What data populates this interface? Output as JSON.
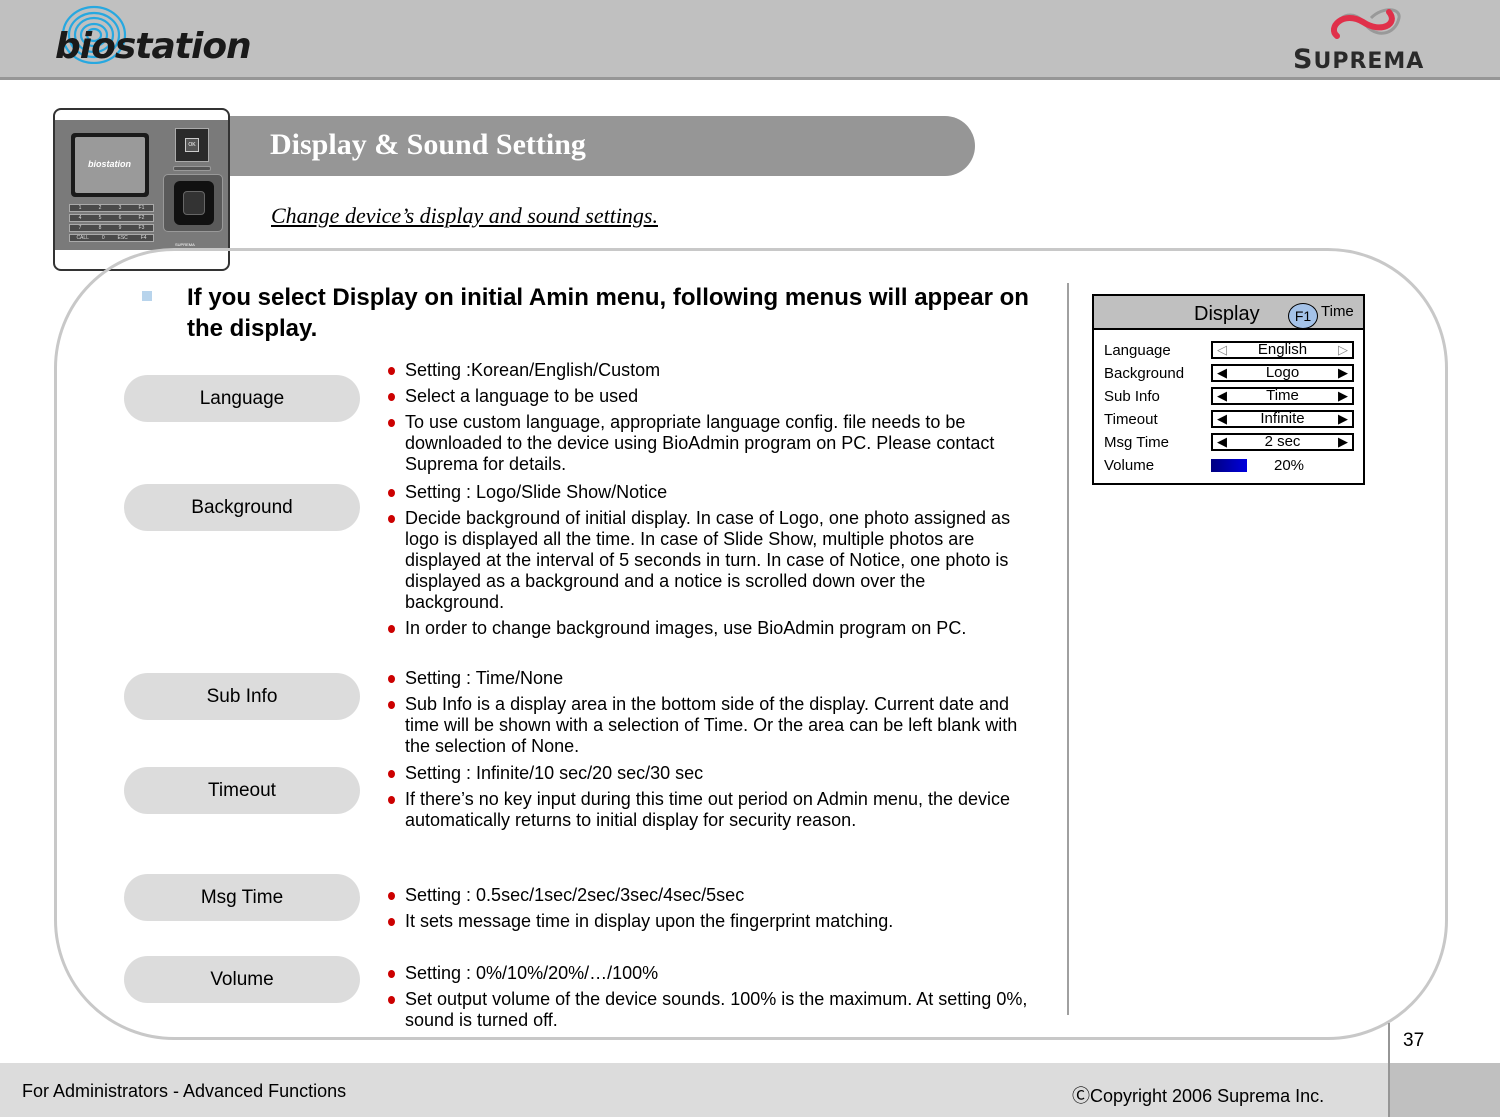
{
  "header": {
    "left_logo_text": "biostation",
    "right_logo_text_first": "S",
    "right_logo_text_rest": "UPREMA",
    "right_logo_accent": "#e0304a",
    "left_logo_accent": "#27a8e0"
  },
  "title": {
    "heading": "Display & Sound Setting",
    "subtitle": "Change device’s display and sound settings."
  },
  "device_image": {
    "screen_logo": "biostation",
    "ok_key": "OK",
    "keypad_rows": [
      [
        "1",
        "2",
        "3",
        "F1"
      ],
      [
        "4",
        "5",
        "6",
        "F2"
      ],
      [
        "7",
        "8",
        "9",
        "F3"
      ],
      [
        "CALL",
        "0",
        "ESC",
        "F4"
      ]
    ],
    "brand": "SUPREMA"
  },
  "intro": "If you select Display on initial Amin menu, following menus will appear on the display.",
  "sections": [
    {
      "label": "Language",
      "bullets": [
        "Setting :Korean/English/Custom",
        "Select a language to be used",
        "To use custom language, appropriate language config. file needs to be downloaded to the device using BioAdmin program on PC. Please contact Suprema for details."
      ]
    },
    {
      "label": "Background",
      "bullets": [
        "Setting : Logo/Slide Show/Notice",
        "Decide background of initial display. In case of Logo, one photo assigned as logo is displayed all the time. In case of Slide Show, multiple photos are displayed at the interval of 5 seconds in turn. In case of Notice, one photo is displayed as a background and a notice is scrolled down over the background.",
        "In order to change background images, use BioAdmin program on PC."
      ]
    },
    {
      "label": "Sub Info",
      "bullets": [
        "Setting : Time/None",
        "Sub Info is a display area in the bottom side of the display. Current date and time will be shown with a selection of Time. Or the area can be left blank with the selection of None."
      ]
    },
    {
      "label": "Timeout",
      "bullets": [
        "Setting : Infinite/10 sec/20 sec/30 sec",
        "If there’s no key input during this time out period on Admin menu, the device automatically returns to initial display for security reason."
      ]
    },
    {
      "label": "Msg Time",
      "bullets": [
        "Setting : 0.5sec/1sec/2sec/3sec/4sec/5sec",
        "It sets message time in display upon the fingerprint matching."
      ]
    },
    {
      "label": "Volume",
      "bullets": [
        "Setting : 0%/10%/20%/…/100%",
        "Set output volume of the device sounds. 100% is the maximum. At setting 0%, sound is turned off."
      ]
    }
  ],
  "display_panel": {
    "title": "Display",
    "f1_badge": "F1",
    "f1_label": "Time",
    "rows": [
      {
        "label": "Language",
        "value": "English",
        "left_arrow": "◁",
        "right_arrow": "▷"
      },
      {
        "label": "Background",
        "value": "Logo",
        "left_arrow": "◀",
        "right_arrow": "▶"
      },
      {
        "label": "Sub Info",
        "value": "Time",
        "left_arrow": "◀",
        "right_arrow": "▶"
      },
      {
        "label": "Timeout",
        "value": "Infinite",
        "left_arrow": "◀",
        "right_arrow": "▶"
      },
      {
        "label": "Msg Time",
        "value": "2 sec",
        "left_arrow": "◀",
        "right_arrow": "▶"
      }
    ],
    "volume": {
      "label": "Volume",
      "value": "20%",
      "level_percent": 20
    }
  },
  "footer": {
    "left": "For Administrators - Advanced Functions",
    "copyright": "ⒸCopyright 2006 Suprema Inc.",
    "page_number": "37"
  }
}
